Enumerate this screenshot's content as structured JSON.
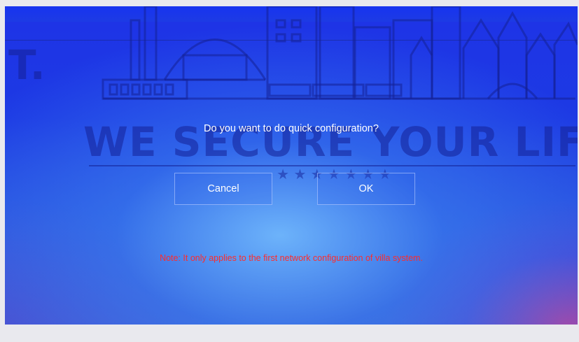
{
  "dialog": {
    "message": "Do you want to do quick configuration?",
    "cancel_label": "Cancel",
    "ok_label": "OK",
    "note": "Note: It only applies to the first network configuration of villa system."
  },
  "background": {
    "watermark_text": "WE SECURE YOUR LIFE",
    "logo_fragment": "T.",
    "stars": "★ ★ ★ ★ ★ ★ ★"
  },
  "colors": {
    "background_top": "#1e33e6",
    "background_glow": "#78c3ff",
    "note_text": "#ff2b2b",
    "text": "#ffffff"
  }
}
